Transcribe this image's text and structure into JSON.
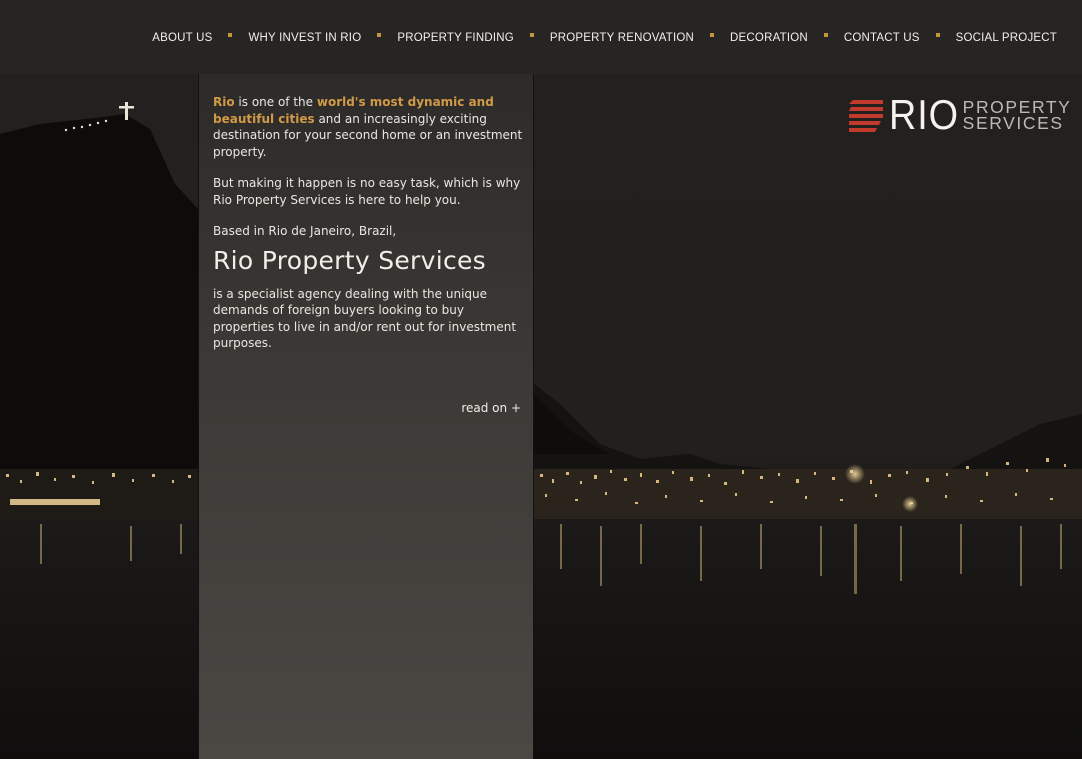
{
  "nav": {
    "items": [
      "ABOUT US",
      "WHY INVEST IN RIO",
      "PROPERTY FINDING",
      "PROPERTY RENOVATION",
      "DECORATION",
      "CONTACT US",
      "SOCIAL PROJECT"
    ]
  },
  "logo": {
    "rio": "RIO",
    "line1": "PROPERTY",
    "line2": "SERVICES",
    "mark_color": "#c0392b"
  },
  "intro": {
    "p1_hl1": "Rio",
    "p1_t1": " is one of the ",
    "p1_hl2": "world's most dynamic and beautiful cities",
    "p1_t2": " and an increasingly exciting destination for your second home or an investment property.",
    "p2": "But making it happen is no easy task, which is why Rio Property Services is here to help you.",
    "based": "Based in Rio de Janeiro, Brazil,",
    "company": "Rio Property Services",
    "p3": "is a specialist agency dealing with the unique demands of foreign buyers looking to buy properties to live in and/or rent out for investment purposes.",
    "read_on": "read on +"
  },
  "colors": {
    "accent": "#d29a47",
    "nav_bg": "#272523",
    "separator": "#c8923a"
  }
}
